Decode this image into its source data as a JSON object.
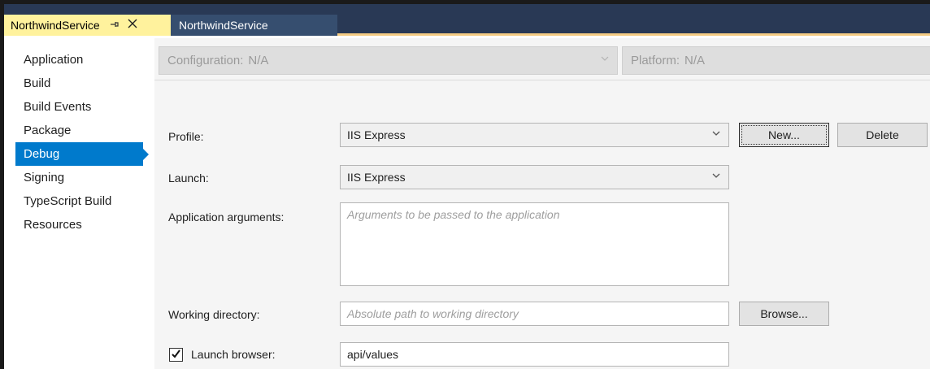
{
  "tabs": {
    "active_label": "NorthwindService",
    "pin_icon": "pin-icon",
    "close_icon": "close-icon",
    "inactive_label": "NorthwindService"
  },
  "nav": {
    "items": [
      {
        "label": "Application"
      },
      {
        "label": "Build"
      },
      {
        "label": "Build Events"
      },
      {
        "label": "Package"
      },
      {
        "label": "Debug",
        "selected": true
      },
      {
        "label": "Signing"
      },
      {
        "label": "TypeScript Build"
      },
      {
        "label": "Resources"
      }
    ]
  },
  "config": {
    "configuration_label": "Configuration:",
    "configuration_value": "N/A",
    "platform_label": "Platform:",
    "platform_value": "N/A"
  },
  "form": {
    "profile_label": "Profile:",
    "profile_value": "IIS Express",
    "new_button": "New...",
    "delete_button": "Delete",
    "launch_label": "Launch:",
    "launch_value": "IIS Express",
    "app_args_label": "Application arguments:",
    "app_args_placeholder": "Arguments to be passed to the application",
    "working_dir_label": "Working directory:",
    "working_dir_placeholder": "Absolute path to working directory",
    "browse_button": "Browse...",
    "launch_browser_label": "Launch browser:",
    "launch_browser_checked": true,
    "launch_browser_value": "api/values"
  },
  "colors": {
    "tabstrip_bg": "#293955",
    "active_tab_bg": "#fff29d",
    "selected_nav_bg": "#007acc"
  }
}
